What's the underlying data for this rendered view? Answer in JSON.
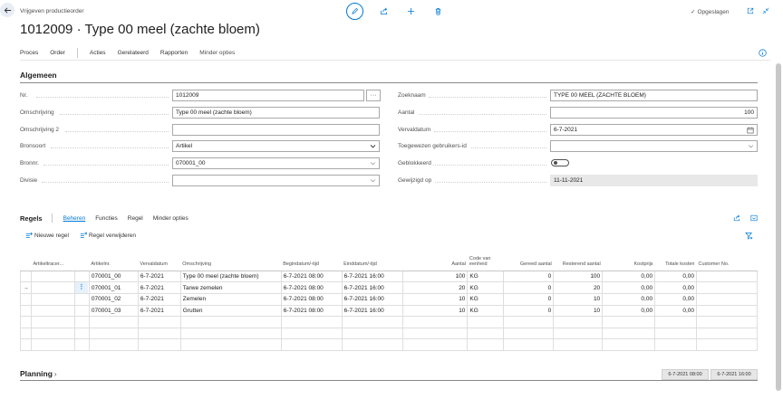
{
  "header": {
    "breadcrumb": "Vrijgeven productieorder",
    "title": "1012009 · Type 00 meel (zachte bloem)",
    "saved_label": "Opgeslagen"
  },
  "action_bar": {
    "items": [
      "Proces",
      "Order",
      "Acties",
      "Gerelateerd",
      "Rapporten",
      "Minder opties"
    ]
  },
  "general": {
    "section_title": "Algemeen",
    "left": {
      "nr_label": "Nr.",
      "nr_value": "1012009",
      "omschrijving_label": "Omschrijving",
      "omschrijving_value": "Type 00 meel (zachte bloem)",
      "omschrijving2_label": "Omschrijving 2",
      "omschrijving2_value": "",
      "bronsoort_label": "Bronsoort",
      "bronsoort_value": "Artikel",
      "bronnr_label": "Bronnr.",
      "bronnr_value": "070001_00",
      "divisie_label": "Divisie",
      "divisie_value": ""
    },
    "right": {
      "zoeknaam_label": "Zoeknaam",
      "zoeknaam_value": "TYPE 00 MEEL (ZACHTE BLOEM)",
      "aantal_label": "Aantal",
      "aantal_value": "100",
      "vervaldatum_label": "Vervaldatum",
      "vervaldatum_value": "6-7-2021",
      "toegewezen_label": "Toegewezen gebruikers-id",
      "toegewezen_value": "",
      "geblokkeerd_label": "Geblokkeerd",
      "geblokkeerd_value": false,
      "gewijzigd_label": "Gewijzigd op",
      "gewijzigd_value": "11-11-2021"
    }
  },
  "lines": {
    "title": "Regels",
    "tabs": [
      "Beheren",
      "Functies",
      "Regel",
      "Minder opties"
    ],
    "new_line": "Nieuwe regel",
    "delete_line": "Regel verwijderen",
    "columns": [
      "Artikeltracer...",
      "Artikelnr.",
      "Vervaldatum",
      "Omschrijving",
      "Begindatum/-tijd",
      "Einddatum/-tijd",
      "Aantal",
      "Code van eenheid",
      "Gereed aantal",
      "Resterend aantal",
      "Kostprijs",
      "Totale kosten",
      "Customer No."
    ],
    "rows": [
      {
        "artikelnr": "070001_00",
        "vervaldatum": "6-7-2021",
        "omschrijving": "Type 00 meel (zachte bloem)",
        "begin": "6-7-2021 08:00",
        "eind": "6-7-2021 16:00",
        "aantal": "100",
        "eenheid": "KG",
        "gereed": "0",
        "resterend": "100",
        "kostprijs": "0,00",
        "totale": "0,00",
        "customer": ""
      },
      {
        "artikelnr": "070001_01",
        "vervaldatum": "6-7-2021",
        "omschrijving": "Tarwe zemelen",
        "begin": "6-7-2021 08:00",
        "eind": "6-7-2021 16:00",
        "aantal": "20",
        "eenheid": "KG",
        "gereed": "0",
        "resterend": "20",
        "kostprijs": "0,00",
        "totale": "0,00",
        "customer": ""
      },
      {
        "artikelnr": "070001_02",
        "vervaldatum": "6-7-2021",
        "omschrijving": "Zemelen",
        "begin": "6-7-2021 08:00",
        "eind": "6-7-2021 16:00",
        "aantal": "10",
        "eenheid": "KG",
        "gereed": "0",
        "resterend": "10",
        "kostprijs": "0,00",
        "totale": "0,00",
        "customer": ""
      },
      {
        "artikelnr": "070001_03",
        "vervaldatum": "6-7-2021",
        "omschrijving": "Grutten",
        "begin": "6-7-2021 08:00",
        "eind": "6-7-2021 16:00",
        "aantal": "10",
        "eenheid": "KG",
        "gereed": "0",
        "resterend": "10",
        "kostprijs": "0,00",
        "totale": "0,00",
        "customer": ""
      }
    ],
    "selected_row_marker": "→",
    "row_menu": "⋮"
  },
  "planning": {
    "title": "Planning",
    "chevron": "›",
    "start": "6-7-2021 08:00",
    "end": "6-7-2021 16:00"
  },
  "icons": {
    "back": "back-arrow-icon",
    "edit": "pencil-icon",
    "share": "share-icon",
    "add": "plus-icon",
    "delete": "trash-icon",
    "open_new": "open-new-window-icon",
    "collapse": "collapse-icon",
    "info": "info-icon",
    "lookup": "ellipsis-icon",
    "dropdown": "chevron-down-icon",
    "calendar": "calendar-icon",
    "filter": "filter-icon"
  },
  "colors": {
    "accent": "#0078d4",
    "readonly_bg": "#e8e8e8"
  }
}
